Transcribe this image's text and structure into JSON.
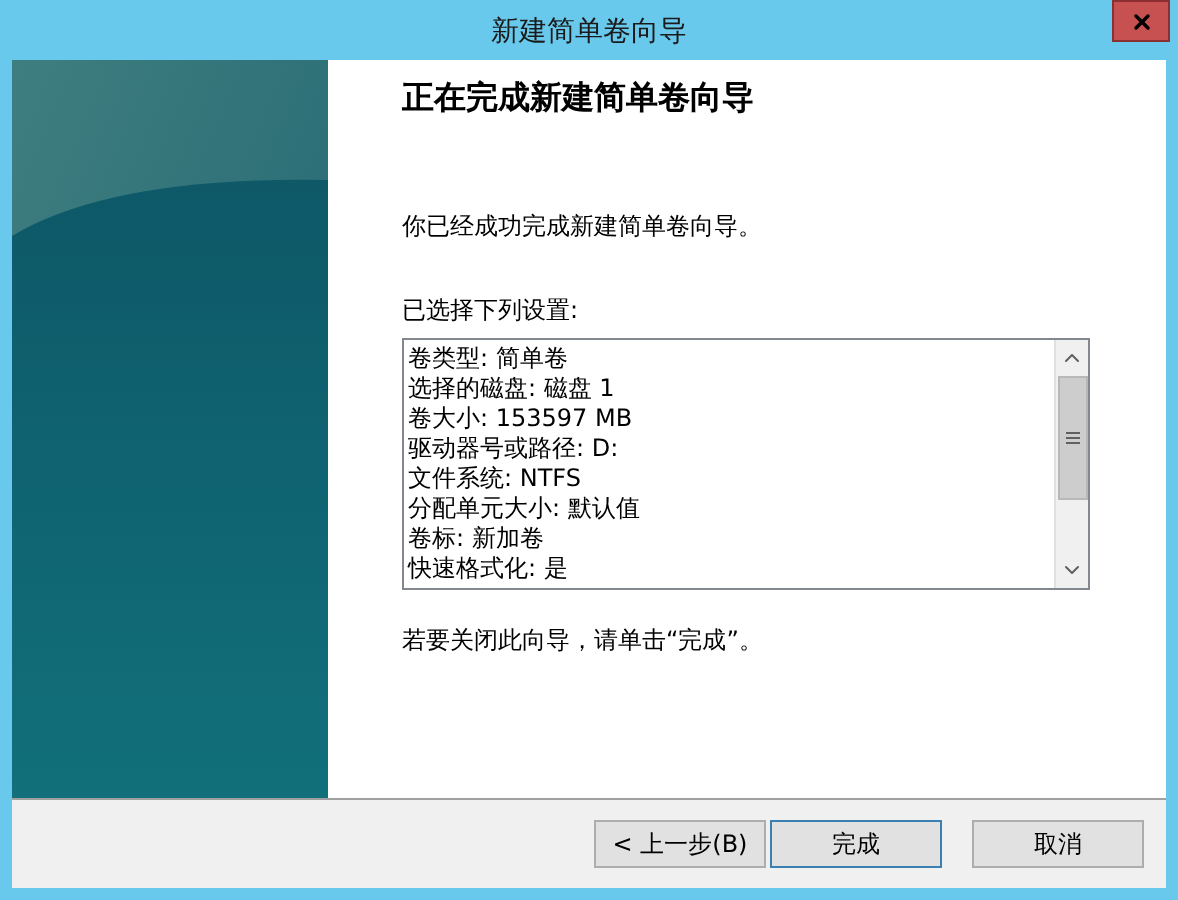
{
  "window": {
    "title": "新建简单卷向导"
  },
  "heading": "正在完成新建简单卷向导",
  "message": "你已经成功完成新建简单卷向导。",
  "settings": {
    "label": "已选择下列设置:",
    "lines": [
      "卷类型: 简单卷",
      "选择的磁盘: 磁盘 1",
      "卷大小: 153597 MB",
      "驱动器号或路径: D:",
      "文件系统: NTFS",
      "分配单元大小: 默认值",
      "卷标: 新加卷",
      "快速格式化: 是"
    ]
  },
  "instruction": "若要关闭此向导，请单击“完成”。",
  "buttons": [
    {
      "label": "< 上一步(B)",
      "default": false
    },
    {
      "label": "完成",
      "default": true
    },
    {
      "label": "取消",
      "default": false
    }
  ]
}
